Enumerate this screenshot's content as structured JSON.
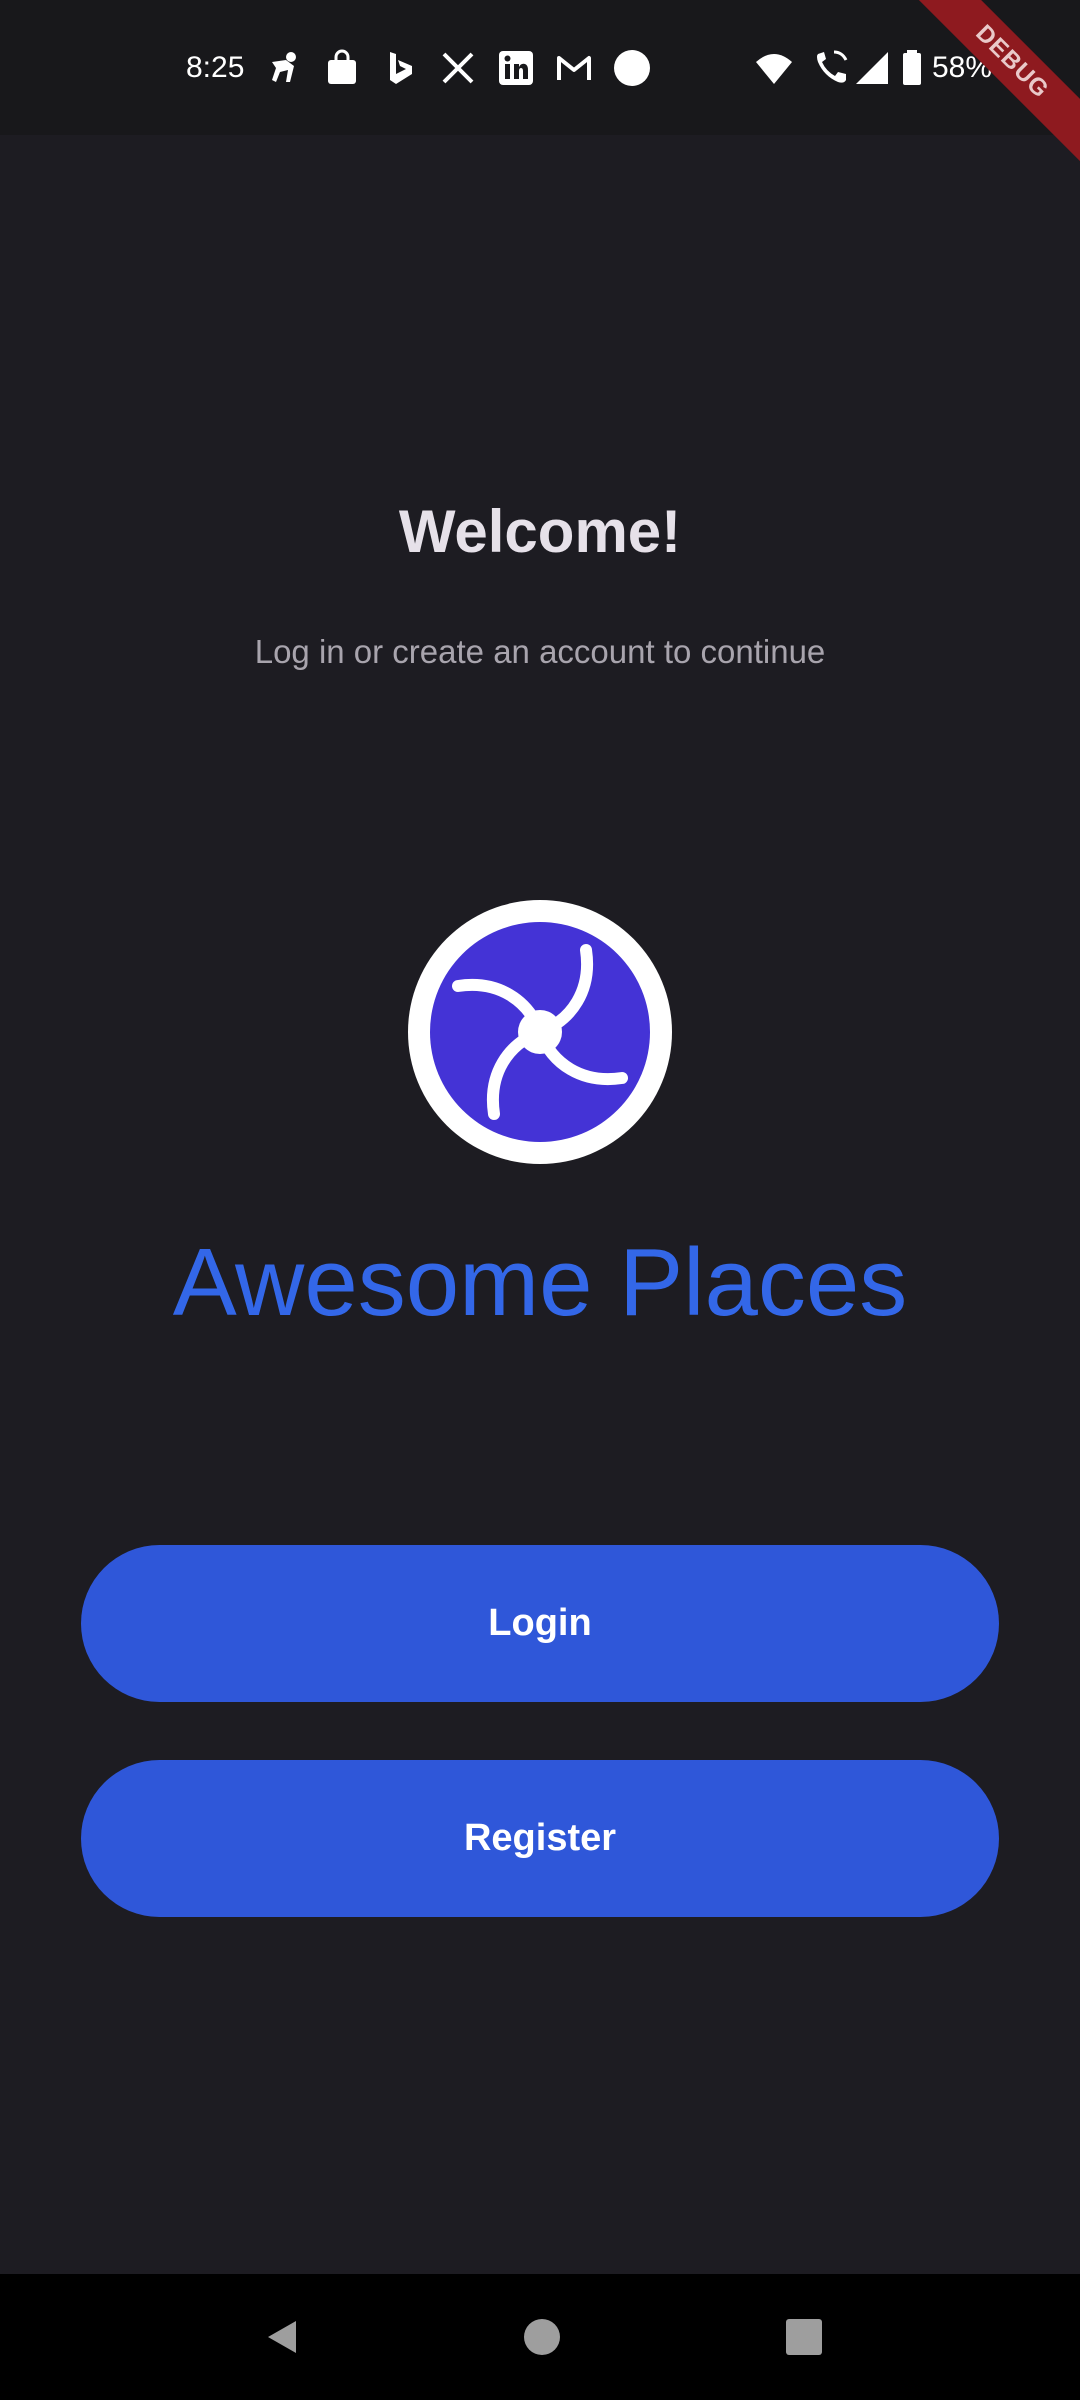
{
  "status_bar": {
    "time": "8:25",
    "battery_percent": "58%",
    "notification_icons": [
      "running-person-icon",
      "shopping-bag-icon",
      "bing-icon",
      "x-icon",
      "linkedin-icon",
      "gmail-icon",
      "white-circle-icon"
    ],
    "system_icons": [
      "wifi-icon",
      "wifi-calling-icon",
      "signal-icon",
      "battery-icon"
    ]
  },
  "debug_banner": "DEBUG",
  "welcome": {
    "title": "Welcome!",
    "subtitle": "Log in or create an account to continue"
  },
  "branding": {
    "logo_icon": "swirl-logo-icon",
    "app_name": "Awesome Places"
  },
  "actions": {
    "login_label": "Login",
    "register_label": "Register"
  },
  "nav_bar": {
    "items": [
      "back-icon",
      "home-icon",
      "recents-icon"
    ]
  },
  "colors": {
    "background": "#1d1c22",
    "accent": "#2f57d9",
    "brand_text": "#3367e8",
    "logo_swirl": "#4433d6",
    "debug_ribbon": "#8e1a1f"
  }
}
